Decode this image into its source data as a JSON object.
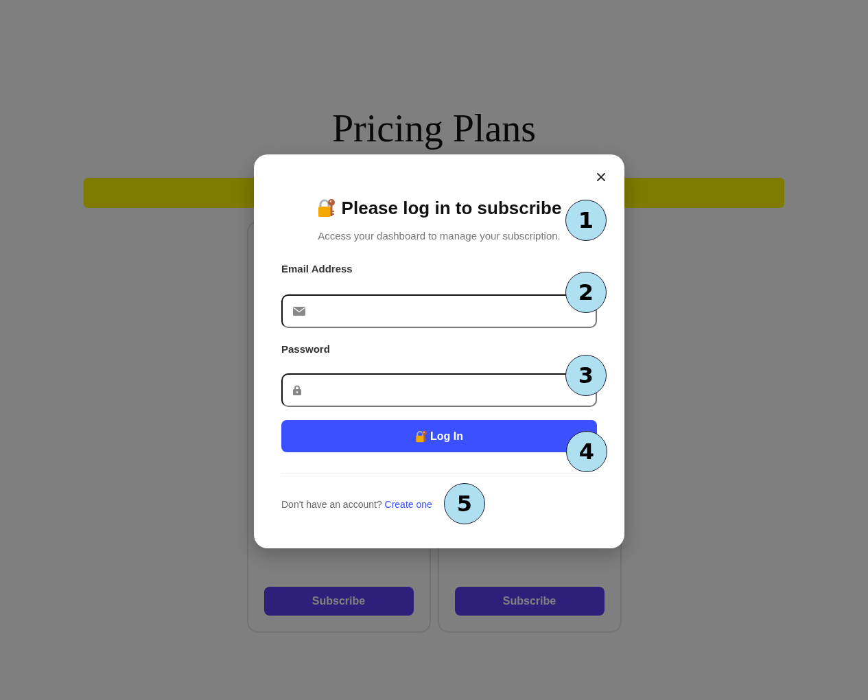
{
  "page": {
    "title": "Pricing Plans",
    "plans": [
      {
        "button": "Subscribe"
      },
      {
        "button": "Subscribe"
      }
    ]
  },
  "modal": {
    "title": "Please log in to subscribe",
    "subtitle": "Access your dashboard to manage your subscription.",
    "fields": [
      {
        "kind": "email",
        "label": "Email Address"
      },
      {
        "kind": "password",
        "label": "Password"
      }
    ],
    "submit": "Log In",
    "footer": {
      "text": "Don't have an account?",
      "link": "Create one"
    }
  },
  "callouts": [
    "1",
    "2",
    "3",
    "4",
    "5"
  ]
}
